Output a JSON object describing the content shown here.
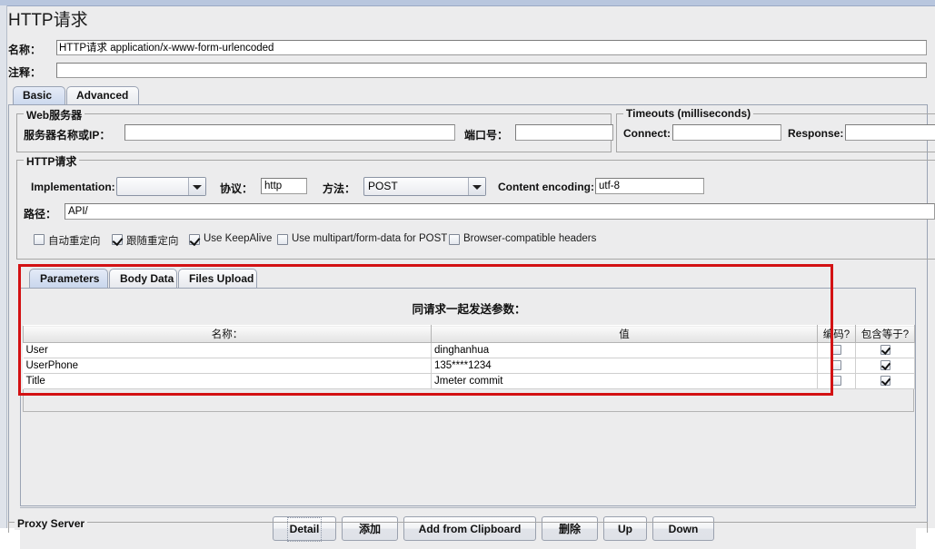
{
  "window": {
    "title": "HTTP请求"
  },
  "header": {
    "name_label": "名称：",
    "name_value": "HTTP请求  application/x-www-form-urlencoded",
    "comment_label": "注释：",
    "comment_value": ""
  },
  "main_tabs": [
    {
      "label": "Basic",
      "selected": true
    },
    {
      "label": "Advanced",
      "selected": false
    }
  ],
  "web_server": {
    "group_title": "Web服务器",
    "server_label": "服务器名称或IP：",
    "server_value": "",
    "port_label": "端口号：",
    "port_value": ""
  },
  "timeouts": {
    "group_title": "Timeouts (milliseconds)",
    "connect_label": "Connect:",
    "connect_value": "",
    "response_label": "Response:",
    "response_value": ""
  },
  "http_request": {
    "group_title": "HTTP请求",
    "implementation_label": "Implementation:",
    "implementation_value": "",
    "protocol_label": "协议：",
    "protocol_value": "http",
    "method_label": "方法：",
    "method_value": "POST",
    "content_encoding_label": "Content encoding:",
    "content_encoding_value": "utf-8",
    "path_label": "路径：",
    "path_value": "API/"
  },
  "options": [
    {
      "label": "自动重定向",
      "checked": false
    },
    {
      "label": "跟随重定向",
      "checked": true
    },
    {
      "label": "Use KeepAlive",
      "checked": true
    },
    {
      "label": "Use multipart/form-data for POST",
      "checked": false
    },
    {
      "label": "Browser-compatible headers",
      "checked": false
    }
  ],
  "param_tabs": [
    {
      "label": "Parameters",
      "selected": true
    },
    {
      "label": "Body Data",
      "selected": false
    },
    {
      "label": "Files Upload",
      "selected": false
    }
  ],
  "params_panel": {
    "caption": "同请求一起发送参数：",
    "columns": [
      "名称：",
      "值",
      "编码?",
      "包含等于?"
    ],
    "rows": [
      {
        "name": "User",
        "value": "dinghanhua",
        "encode": false,
        "include_equals": true
      },
      {
        "name": "UserPhone",
        "value": "135****1234",
        "encode": false,
        "include_equals": true
      },
      {
        "name": "Title",
        "value": "Jmeter commit",
        "encode": false,
        "include_equals": true
      }
    ]
  },
  "buttons": [
    {
      "label": "Detail",
      "focused": true
    },
    {
      "label": "添加",
      "focused": false
    },
    {
      "label": "Add from Clipboard",
      "focused": false
    },
    {
      "label": "删除",
      "focused": false
    },
    {
      "label": "Up",
      "focused": false
    },
    {
      "label": "Down",
      "focused": false
    }
  ],
  "proxy": {
    "group_title": "Proxy Server"
  },
  "annotation": {
    "color": "#d31113"
  }
}
